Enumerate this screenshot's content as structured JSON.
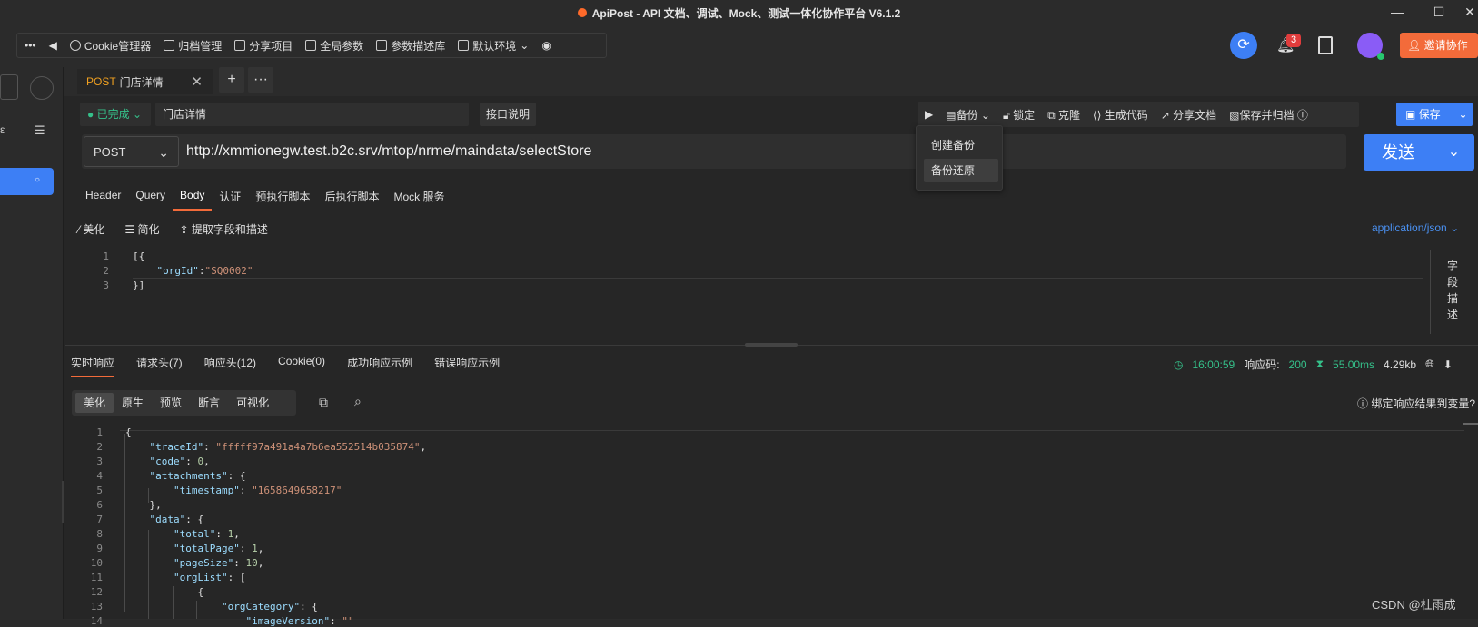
{
  "window": {
    "title": "ApiPost - API 文档、调试、Mock、测试一体化协作平台 V6.1.2"
  },
  "toolbar": {
    "items": [
      "Cookie管理器",
      "归档管理",
      "分享项目",
      "全局参数",
      "参数描述库",
      "默认环境"
    ],
    "notif_count": "3",
    "invite_label": "邀请协作"
  },
  "tab": {
    "method": "POST",
    "name": "门店详情"
  },
  "request": {
    "status": "已完成",
    "name": "门店详情",
    "explain_label": "接口说明",
    "actions": [
      "备份",
      "锁定",
      "克隆",
      "生成代码",
      "分享文档",
      "保存并归档"
    ],
    "save_label": "保存",
    "method": "POST",
    "url": "http://xmmionegw.test.b2c.srv/mtop/nrme/maindata/selectStore",
    "send_label": "发送"
  },
  "backup_menu": {
    "items": [
      "创建备份",
      "备份还原"
    ]
  },
  "subtabs": [
    "Header",
    "Query",
    "Body",
    "认证",
    "预执行脚本",
    "后执行脚本",
    "Mock 服务"
  ],
  "body_tools": [
    "美化",
    "简化",
    "提取字段和描述"
  ],
  "content_type": "application/json",
  "field_desc_label": "字段描述",
  "body_code": {
    "line_numbers": [
      "1",
      "2",
      "3"
    ],
    "lines": [
      "[{",
      "    \"orgId\":\"SQ0002\"",
      "}]"
    ]
  },
  "response": {
    "tabs": [
      "实时响应",
      "请求头(7)",
      "响应头(12)",
      "Cookie(0)",
      "成功响应示例",
      "错误响应示例"
    ],
    "time": "16:00:59",
    "code_label": "响应码:",
    "code": "200",
    "duration": "55.00ms",
    "size": "4.29kb",
    "view_tabs": [
      "美化",
      "原生",
      "预览",
      "断言",
      "可视化"
    ],
    "bind_hint": "绑定响应结果到变量?",
    "line_numbers": [
      "1",
      "2",
      "3",
      "4",
      "5",
      "6",
      "7",
      "8",
      "9",
      "10",
      "11",
      "12",
      "13",
      "14"
    ],
    "lines": [
      "{",
      "    \"traceId\": \"fffff97a491a4a7b6ea552514b035874\",",
      "    \"code\": 0,",
      "    \"attachments\": {",
      "        \"timestamp\": \"1658649658217\"",
      "    },",
      "    \"data\": {",
      "        \"total\": 1,",
      "        \"totalPage\": 1,",
      "        \"pageSize\": 10,",
      "        \"orgList\": [",
      "            {",
      "                \"orgCategory\": {",
      "                    \"imageVersion\": \"\""
    ]
  },
  "watermark": "CSDN @杜雨成"
}
